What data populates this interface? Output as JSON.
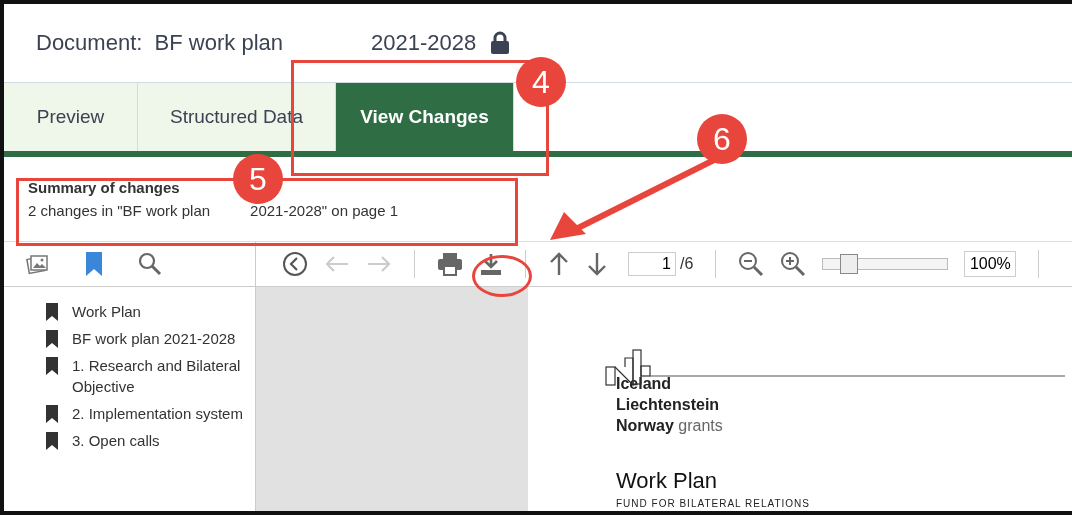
{
  "document": {
    "label": "Document:",
    "name": "BF work plan",
    "period": "2021-2028",
    "locked": true
  },
  "tabs": [
    {
      "label": "Preview",
      "selected": false
    },
    {
      "label": "Structured Data",
      "selected": false
    },
    {
      "label": "View Changes",
      "selected": true
    }
  ],
  "summary": {
    "title": "Summary of changes",
    "text_1": "2 changes in \"BF work plan",
    "text_2": "2021-2028\" on page 1"
  },
  "toolbar": {
    "page": "1",
    "page_count": "/6",
    "zoom": {
      "level": 0.2,
      "value": "100%"
    },
    "back_disabled": true,
    "forward_disabled": true
  },
  "bookmarks": [
    {
      "label": "Work Plan"
    },
    {
      "label": "BF work plan 2021-2028"
    },
    {
      "label": "1. Research and Bilateral Objective"
    },
    {
      "label": "2. Implementation system"
    },
    {
      "label": "3. Open calls"
    }
  ],
  "page": {
    "logo": [
      "Iceland",
      "Liechtenstein",
      "Norway",
      "grants"
    ],
    "title": "Work Plan",
    "subtitle": "FUND FOR BILATERAL RELATIONS"
  },
  "callouts": [
    {
      "label": "4"
    },
    {
      "label": "5"
    },
    {
      "label": "6"
    }
  ]
}
